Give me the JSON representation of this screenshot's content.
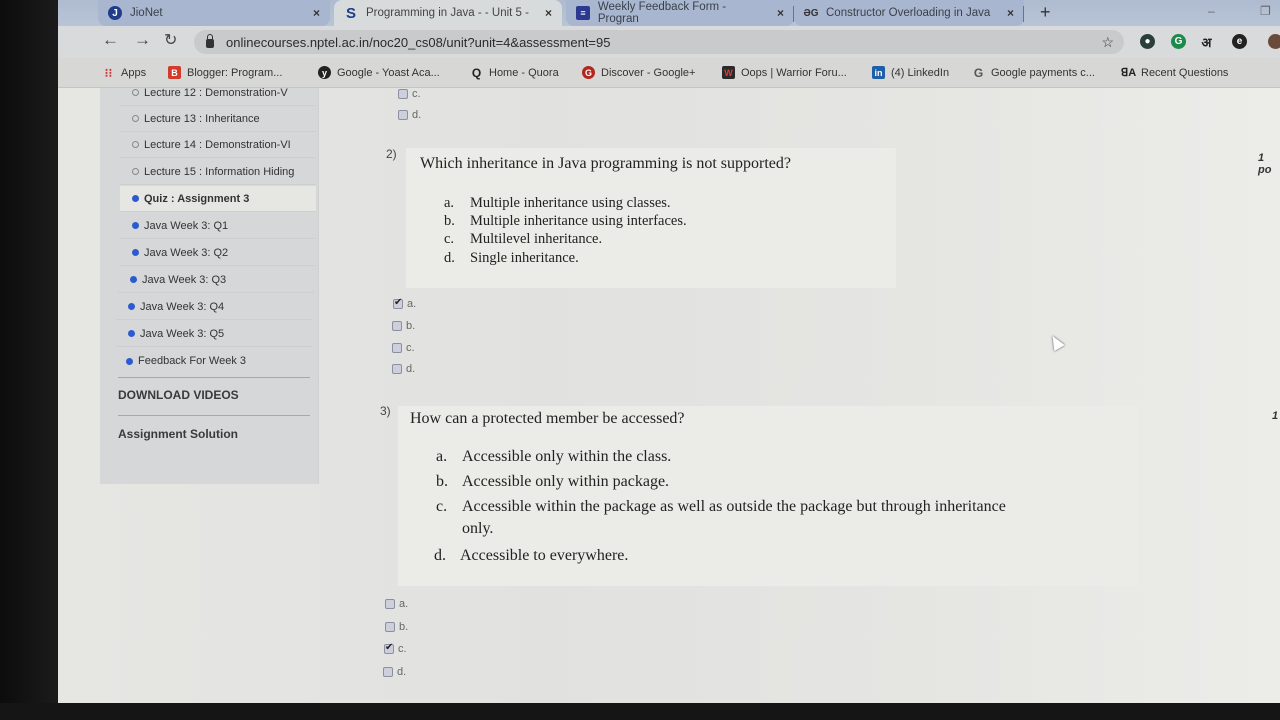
{
  "browser": {
    "tabs": [
      {
        "label": "JioNet",
        "favicon": "jio-icon",
        "active": false
      },
      {
        "label": "Programming in Java - - Unit 5 -",
        "favicon": "swayam-s-icon",
        "active": true
      },
      {
        "label": "Weekly Feedback Form - Progran",
        "favicon": "google-forms-icon",
        "active": false
      },
      {
        "label": "Constructor Overloading in Java",
        "favicon": "gfg-icon",
        "active": false
      }
    ],
    "new_tab": "+",
    "close_glyph": "×",
    "url": "onlinecourses.nptel.ac.in/noc20_cs08/unit?unit=4&assessment=95",
    "extensions": [
      "extension-globe-icon",
      "grammarly-icon",
      "hindi-input-icon",
      "extension-e-icon"
    ],
    "bookmarks": [
      {
        "label": "Apps",
        "icon": "apps-grid-icon"
      },
      {
        "label": "Blogger: Program...",
        "icon": "blogger-icon"
      },
      {
        "label": "Google - Yoast Aca...",
        "icon": "yoast-icon"
      },
      {
        "label": "Home - Quora",
        "icon": "quora-icon"
      },
      {
        "label": "Discover - Google+",
        "icon": "google-plus-icon"
      },
      {
        "label": "Oops | Warrior Foru...",
        "icon": "warrior-forum-icon"
      },
      {
        "label": "(4) LinkedIn",
        "icon": "linkedin-icon"
      },
      {
        "label": "Google payments c...",
        "icon": "google-icon"
      },
      {
        "label": "Recent Questions",
        "icon": "brainly-icon"
      }
    ]
  },
  "sidebar": {
    "items": [
      {
        "label": "Lecture 12 : Demonstration-V",
        "filled": false,
        "active": false
      },
      {
        "label": "Lecture 13 : Inheritance",
        "filled": false,
        "active": false
      },
      {
        "label": "Lecture 14 : Demonstration-VI",
        "filled": false,
        "active": false
      },
      {
        "label": "Lecture 15 : Information Hiding",
        "filled": false,
        "active": false
      },
      {
        "label": "Quiz : Assignment 3",
        "filled": true,
        "active": true
      },
      {
        "label": "Java Week 3: Q1",
        "filled": true,
        "active": false
      },
      {
        "label": "Java Week 3: Q2",
        "filled": true,
        "active": false
      },
      {
        "label": "Java Week 3: Q3",
        "filled": true,
        "active": false
      },
      {
        "label": "Java Week 3: Q4",
        "filled": true,
        "active": false
      },
      {
        "label": "Java Week 3: Q5",
        "filled": true,
        "active": false
      },
      {
        "label": "Feedback For Week 3",
        "filled": true,
        "active": false
      }
    ],
    "sections": [
      "DOWNLOAD VIDEOS",
      "Assignment Solution"
    ]
  },
  "quiz": {
    "q1_tail": {
      "choices": [
        {
          "label": "c.",
          "checked": false
        },
        {
          "label": "d.",
          "checked": false
        }
      ]
    },
    "questions": [
      {
        "number": "2)",
        "text": "Which inheritance in Java programming is not supported?",
        "points": "1 po",
        "options": [
          {
            "letter": "a.",
            "text": "Multiple inheritance using classes."
          },
          {
            "letter": "b.",
            "text": "Multiple inheritance using interfaces."
          },
          {
            "letter": "c.",
            "text": "Multilevel inheritance."
          },
          {
            "letter": "d.",
            "text": "Single inheritance."
          }
        ],
        "choices": [
          {
            "label": "a.",
            "checked": true
          },
          {
            "label": "b.",
            "checked": false
          },
          {
            "label": "c.",
            "checked": false
          },
          {
            "label": "d.",
            "checked": false
          }
        ]
      },
      {
        "number": "3)",
        "text": "How can a protected member be accessed?",
        "points": "1",
        "options": [
          {
            "letter": "a.",
            "text": "Accessible only within the class."
          },
          {
            "letter": "b.",
            "text": "Accessible only within package."
          },
          {
            "letter": "c.",
            "text": "Accessible within the package as well as outside the package but through inheritance",
            "text_cont": "only."
          },
          {
            "letter": "d.",
            "text": "Accessible to everywhere."
          }
        ],
        "choices": [
          {
            "label": "a.",
            "checked": false
          },
          {
            "label": "b.",
            "checked": false
          },
          {
            "label": "c.",
            "checked": true
          },
          {
            "label": "d.",
            "checked": false
          }
        ]
      }
    ]
  }
}
